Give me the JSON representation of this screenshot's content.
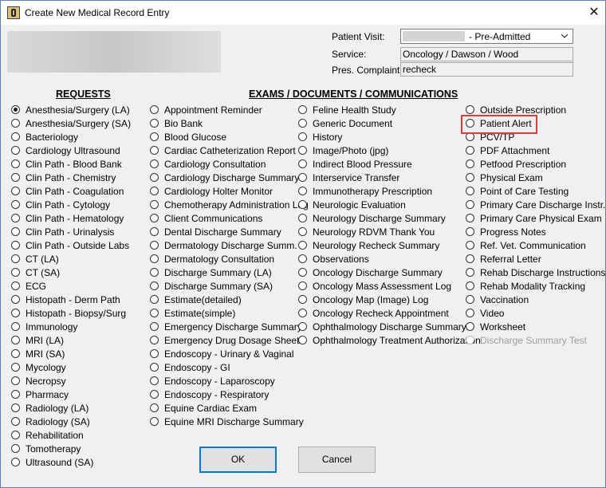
{
  "window": {
    "title": "Create New Medical Record Entry"
  },
  "patient": {
    "visit_label": "Patient Visit:",
    "visit_value": "- Pre-Admitted",
    "service_label": "Service:",
    "service_value": "Oncology / Dawson / Wood",
    "complaint_label": "Pres. Complaint:",
    "complaint_value": "recheck"
  },
  "headers": {
    "requests": "REQUESTS",
    "exams": "EXAMS / DOCUMENTS / COMMUNICATIONS"
  },
  "columns": [
    {
      "items": [
        {
          "label": "Anesthesia/Surgery (LA)",
          "checked": true
        },
        {
          "label": "Anesthesia/Surgery (SA)"
        },
        {
          "label": "Bacteriology"
        },
        {
          "label": "Cardiology Ultrasound"
        },
        {
          "label": "Clin Path - Blood Bank"
        },
        {
          "label": "Clin Path - Chemistry"
        },
        {
          "label": "Clin Path - Coagulation"
        },
        {
          "label": "Clin Path - Cytology"
        },
        {
          "label": "Clin Path - Hematology"
        },
        {
          "label": "Clin Path - Urinalysis"
        },
        {
          "label": "Clin Path - Outside Labs"
        },
        {
          "label": "CT (LA)"
        },
        {
          "label": "CT (SA)"
        },
        {
          "label": "ECG"
        },
        {
          "label": "Histopath - Derm Path"
        },
        {
          "label": "Histopath - Biopsy/Surg"
        },
        {
          "label": "Immunology"
        },
        {
          "label": "MRI (LA)"
        },
        {
          "label": "MRI (SA)"
        },
        {
          "label": "Mycology"
        },
        {
          "label": "Necropsy"
        },
        {
          "label": "Pharmacy"
        },
        {
          "label": "Radiology  (LA)"
        },
        {
          "label": "Radiology  (SA)"
        },
        {
          "label": "Rehabilitation"
        },
        {
          "label": "Tomotherapy"
        },
        {
          "label": "Ultrasound (SA)"
        }
      ]
    },
    {
      "items": [
        {
          "label": "Appointment Reminder"
        },
        {
          "label": "Bio Bank"
        },
        {
          "label": "Blood Glucose"
        },
        {
          "label": "Cardiac Catheterization Report"
        },
        {
          "label": "Cardiology Consultation"
        },
        {
          "label": "Cardiology Discharge Summary"
        },
        {
          "label": "Cardiology Holter Monitor"
        },
        {
          "label": "Chemotherapy Administration Log"
        },
        {
          "label": "Client Communications"
        },
        {
          "label": "Dental Discharge Summary"
        },
        {
          "label": "Dermatology Discharge Summ."
        },
        {
          "label": "Dermatology Consultation"
        },
        {
          "label": "Discharge Summary (LA)"
        },
        {
          "label": "Discharge Summary (SA)"
        },
        {
          "label": "Estimate(detailed)"
        },
        {
          "label": "Estimate(simple)"
        },
        {
          "label": "Emergency Discharge Summary"
        },
        {
          "label": "Emergency Drug Dosage Sheet"
        },
        {
          "label": "Endoscopy - Urinary & Vaginal"
        },
        {
          "label": "Endoscopy - GI"
        },
        {
          "label": "Endoscopy - Laparoscopy"
        },
        {
          "label": "Endoscopy - Respiratory"
        },
        {
          "label": "Equine Cardiac Exam"
        },
        {
          "label": "Equine MRI Discharge Summary"
        }
      ]
    },
    {
      "items": [
        {
          "label": "Feline Health Study"
        },
        {
          "label": "Generic Document"
        },
        {
          "label": "History"
        },
        {
          "label": "Image/Photo (jpg)"
        },
        {
          "label": "Indirect Blood Pressure"
        },
        {
          "label": "Interservice Transfer"
        },
        {
          "label": "Immunotherapy Prescription"
        },
        {
          "label": "Neurologic Evaluation"
        },
        {
          "label": "Neurology Discharge Summary"
        },
        {
          "label": "Neurology RDVM Thank You"
        },
        {
          "label": "Neurology Recheck Summary"
        },
        {
          "label": "Observations"
        },
        {
          "label": "Oncology Discharge Summary"
        },
        {
          "label": "Oncology Mass Assessment Log"
        },
        {
          "label": "Oncology Map (Image) Log"
        },
        {
          "label": "Oncology Recheck Appointment"
        },
        {
          "label": "Ophthalmology Discharge Summary"
        },
        {
          "label": "Ophthalmology Treatment Authorization"
        }
      ]
    },
    {
      "items": [
        {
          "label": "Outside Prescription"
        },
        {
          "label": "Patient Alert",
          "highlighted": true
        },
        {
          "label": "PCV/TP"
        },
        {
          "label": "PDF Attachment"
        },
        {
          "label": "Petfood Prescription"
        },
        {
          "label": "Physical Exam"
        },
        {
          "label": "Point of Care Testing"
        },
        {
          "label": "Primary Care Discharge Instr."
        },
        {
          "label": "Primary Care Physical Exam"
        },
        {
          "label": "Progress Notes"
        },
        {
          "label": "Ref. Vet. Communication"
        },
        {
          "label": "Referral Letter"
        },
        {
          "label": "Rehab Discharge Instructions"
        },
        {
          "label": "Rehab Modality Tracking"
        },
        {
          "label": "Vaccination"
        },
        {
          "label": "Video"
        },
        {
          "label": "Worksheet"
        },
        {
          "label": "Discharge Summary Test",
          "disabled": true
        }
      ]
    }
  ],
  "buttons": {
    "ok": "OK",
    "cancel": "Cancel"
  },
  "colors": {
    "highlight": "#e53a3a",
    "accent": "#0078d7"
  }
}
